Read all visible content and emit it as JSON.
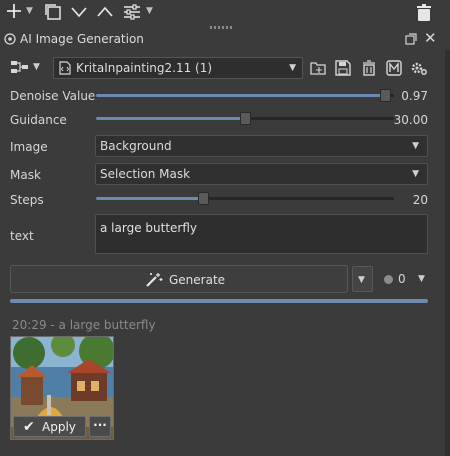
{
  "toolbar": {
    "icons": [
      "plus-icon",
      "caret-down-icon",
      "copy-icon",
      "chevron-down-icon",
      "chevron-up-icon",
      "settings-sliders-icon",
      "caret-down-icon",
      "trash-icon"
    ]
  },
  "panel": {
    "title": "AI Image Generation"
  },
  "workflow": {
    "selected": "KritaInpainting2.11 (1)"
  },
  "fields": {
    "denoise": {
      "label": "Denoise Value",
      "value": "0.97",
      "fraction": 0.97
    },
    "guidance": {
      "label": "Guidance",
      "value": "30.00",
      "fraction": 0.5
    },
    "image": {
      "label": "Image",
      "selected": "Background"
    },
    "mask": {
      "label": "Mask",
      "selected": "Selection Mask"
    },
    "steps": {
      "label": "Steps",
      "value": "20",
      "fraction": 0.36
    },
    "text": {
      "label": "text",
      "value": "a large butterfly"
    }
  },
  "generate": {
    "label": "Generate",
    "queue_count": "0",
    "progress_fraction": 1.0
  },
  "history": {
    "header": "20:29 - a large butterfly",
    "apply_label": "Apply",
    "more_label": "···"
  },
  "colors": {
    "accent": "#6d8bb0",
    "background": "#3b3b3b"
  }
}
